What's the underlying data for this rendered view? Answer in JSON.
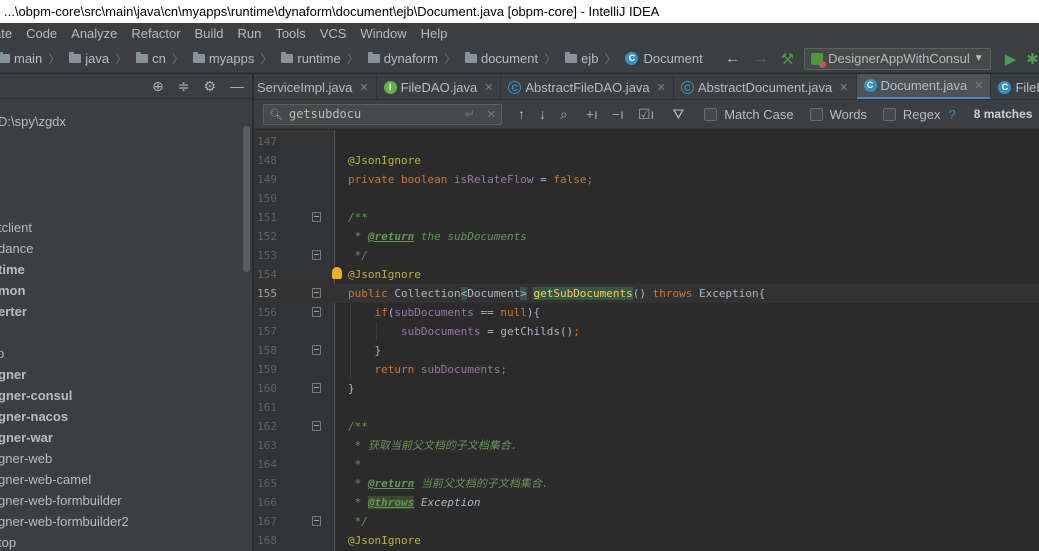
{
  "window": {
    "title": "...\\obpm-core\\src\\main\\java\\cn\\myapps\\runtime\\dynaform\\document\\ejb\\Document.java [obpm-core] - IntelliJ IDEA"
  },
  "menu": [
    "ate",
    "Code",
    "Analyze",
    "Refactor",
    "Build",
    "Run",
    "Tools",
    "VCS",
    "Window",
    "Help"
  ],
  "breadcrumbs": [
    "main",
    "java",
    "cn",
    "myapps",
    "runtime",
    "dynaform",
    "document",
    "ejb"
  ],
  "breadcrumb_class": "Document",
  "run_config": "DesignerAppWithConsul",
  "project": {
    "items": [
      {
        "label": "D:\\spy\\zgdx",
        "bold": false
      },
      {
        "label": "tclient",
        "bold": false
      },
      {
        "label": "dance",
        "bold": false
      },
      {
        "label": "time",
        "bold": true
      },
      {
        "label": "mon",
        "bold": true
      },
      {
        "label": "erter",
        "bold": true
      },
      {
        "label": "p",
        "bold": false
      },
      {
        "label": "gner",
        "bold": true
      },
      {
        "label": "gner-consul",
        "bold": true
      },
      {
        "label": "gner-nacos",
        "bold": true
      },
      {
        "label": "gner-war",
        "bold": true
      },
      {
        "label": "gner-web",
        "bold": false
      },
      {
        "label": "gner-web-camel",
        "bold": false
      },
      {
        "label": "gner-web-formbuilder",
        "bold": false
      },
      {
        "label": "gner-web-formbuilder2",
        "bold": false
      },
      {
        "label": "top",
        "bold": false
      }
    ]
  },
  "tabs": [
    {
      "label": "ServiceImpl.java",
      "icon": "none",
      "active": false
    },
    {
      "label": "FileDAO.java",
      "icon": "interface",
      "active": false
    },
    {
      "label": "AbstractFileDAO.java",
      "icon": "abstract",
      "active": false
    },
    {
      "label": "AbstractDocument.java",
      "icon": "abstract",
      "active": false
    },
    {
      "label": "Document.java",
      "icon": "class",
      "active": true
    },
    {
      "label": "FileEnt",
      "icon": "class",
      "active": false
    }
  ],
  "search": {
    "query": "getsubdocu",
    "match_case_label": "Match Case",
    "words_label": "Words",
    "regex_label": "Regex",
    "help": "?",
    "matches": "8 matches"
  },
  "editor": {
    "current_line": 155,
    "lines": [
      {
        "n": 147,
        "html": ""
      },
      {
        "n": 148,
        "html": "<span class='ann'>@JsonIgnore</span>"
      },
      {
        "n": 149,
        "html": "<span class='kw'>private boolean </span><span class='field'>isRelateFlow</span> = <span class='kw'>false;</span>"
      },
      {
        "n": 150,
        "html": ""
      },
      {
        "n": 151,
        "html": "<span class='doc'>/**</span>",
        "fold": true
      },
      {
        "n": 152,
        "html": "<span class='doc'> * </span><span class='tag'>@return</span><span class='doc'> the subDocuments</span>"
      },
      {
        "n": 153,
        "html": "<span class='doc'> */</span>",
        "fold": true
      },
      {
        "n": 154,
        "html": "<span class='ann'>@JsonIgnore</span>",
        "bulb": true
      },
      {
        "n": 155,
        "html": "<span class='kw'>public </span>Collection<span class='bracematch'>&lt;</span>Document<span class='bracematch'>&gt;</span> <span class='meth found'>getSubDocuments</span>() <span class='kw'>throws </span>Exception{",
        "fold": true
      },
      {
        "n": 156,
        "html": "    <span class='kw'>if</span>(<span class='field'>subDocuments</span> == <span class='kw'>null</span>){",
        "fold": true
      },
      {
        "n": 157,
        "html": "        <span class='field'>subDocuments</span> = getChilds()<span class='kw'>;</span>"
      },
      {
        "n": 158,
        "html": "    }",
        "fold": true
      },
      {
        "n": 159,
        "html": "    <span class='kw'>return </span><span class='field'>subDocuments</span><span class='kw'>;</span>"
      },
      {
        "n": 160,
        "html": "}",
        "fold": true
      },
      {
        "n": 161,
        "html": ""
      },
      {
        "n": 162,
        "html": "<span class='doc'>/**</span>",
        "fold": true
      },
      {
        "n": 163,
        "html": "<span class='doc'> * 获取当前父文档的子文档集合.</span>"
      },
      {
        "n": 164,
        "html": "<span class='doc'> *</span>"
      },
      {
        "n": 165,
        "html": "<span class='doc'> * </span><span class='tag'>@return</span><span class='doc'> 当前父文档的子文档集合.</span>"
      },
      {
        "n": 166,
        "html": "<span class='doc'> * </span><span class='tag tagbg'>@throws</span><span class='doc' style='color:#a9b7c6'> Exception</span>"
      },
      {
        "n": 167,
        "html": "<span class='doc'> */</span>",
        "fold": true
      },
      {
        "n": 168,
        "html": "<span class='ann'>@JsonIgnore</span>"
      }
    ]
  }
}
